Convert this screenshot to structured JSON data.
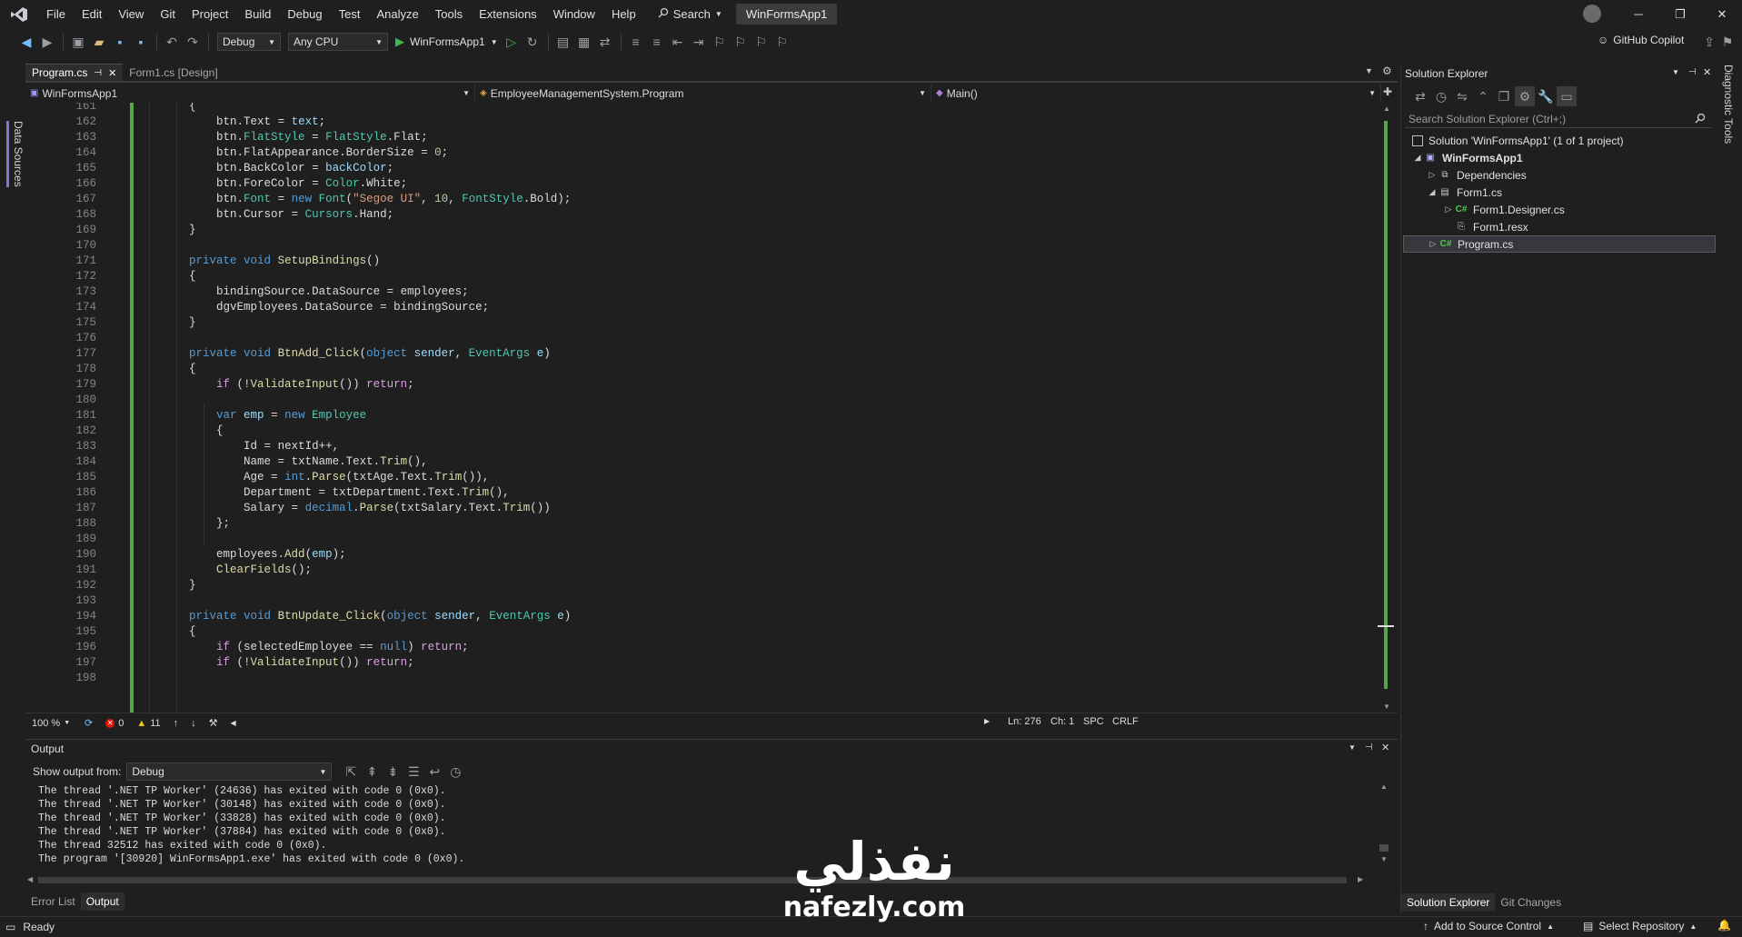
{
  "menubar": {
    "items": [
      "File",
      "Edit",
      "View",
      "Git",
      "Project",
      "Build",
      "Debug",
      "Test",
      "Analyze",
      "Tools",
      "Extensions",
      "Window",
      "Help"
    ],
    "search_label": "Search",
    "app_title": "WinFormsApp1"
  },
  "toolbar": {
    "configuration": "Debug",
    "platform": "Any CPU",
    "run_target": "WinFormsApp1",
    "copilot_label": "GitHub Copilot"
  },
  "left_tab": "Data Sources",
  "right_tab": "Diagnostic Tools",
  "editor": {
    "tabs": [
      {
        "label": "Program.cs",
        "active": true
      },
      {
        "label": "Form1.cs [Design]",
        "active": false
      }
    ],
    "nav_project": "WinFormsApp1",
    "nav_class": "EmployeeManagementSystem.Program",
    "nav_member": "Main()",
    "line_numbers": [
      "161",
      "162",
      "163",
      "164",
      "165",
      "166",
      "167",
      "168",
      "169",
      "170",
      "171",
      "172",
      "173",
      "174",
      "175",
      "176",
      "177",
      "178",
      "179",
      "180",
      "181",
      "182",
      "183",
      "184",
      "185",
      "186",
      "187",
      "188",
      "189",
      "190",
      "191",
      "192",
      "193",
      "194",
      "195",
      "196",
      "197",
      "198"
    ],
    "code_lines": [
      "        {",
      "            btn.Text = text;",
      "            btn.FlatStyle = FlatStyle.Flat;",
      "            btn.FlatAppearance.BorderSize = 0;",
      "            btn.BackColor = backColor;",
      "            btn.ForeColor = Color.White;",
      "            btn.Font = new Font(\"Segoe UI\", 10, FontStyle.Bold);",
      "            btn.Cursor = Cursors.Hand;",
      "        }",
      "",
      "        private void SetupBindings()",
      "        {",
      "            bindingSource.DataSource = employees;",
      "            dgvEmployees.DataSource = bindingSource;",
      "        }",
      "",
      "        private void BtnAdd_Click(object sender, EventArgs e)",
      "        {",
      "            if (!ValidateInput()) return;",
      "",
      "            var emp = new Employee",
      "            {",
      "                Id = nextId++,",
      "                Name = txtName.Text.Trim(),",
      "                Age = int.Parse(txtAge.Text.Trim()),",
      "                Department = txtDepartment.Text.Trim(),",
      "                Salary = decimal.Parse(txtSalary.Text.Trim())",
      "            };",
      "",
      "            employees.Add(emp);",
      "            ClearFields();",
      "        }",
      "",
      "        private void BtnUpdate_Click(object sender, EventArgs e)",
      "        {",
      "            if (selectedEmployee == null) return;",
      "            if (!ValidateInput()) return;",
      ""
    ],
    "status": {
      "zoom": "100 %",
      "errors": "0",
      "warnings": "11",
      "line": "Ln: 276",
      "char": "Ch: 1",
      "whitespace": "SPC",
      "line_ending": "CRLF"
    }
  },
  "output": {
    "title": "Output",
    "show_from_label": "Show output from:",
    "source": "Debug",
    "lines": [
      "The thread '.NET TP Worker' (24636) has exited with code 0 (0x0).",
      "The thread '.NET TP Worker' (30148) has exited with code 0 (0x0).",
      "The thread '.NET TP Worker' (33828) has exited with code 0 (0x0).",
      "The thread '.NET TP Worker' (37884) has exited with code 0 (0x0).",
      "The thread 32512 has exited with code 0 (0x0).",
      "The program '[30920] WinFormsApp1.exe' has exited with code 0 (0x0)."
    ],
    "bottom_tabs": [
      "Error List",
      "Output"
    ]
  },
  "solution_explorer": {
    "title": "Solution Explorer",
    "search_placeholder": "Search Solution Explorer (Ctrl+;)",
    "tree": [
      {
        "label": "Solution 'WinFormsApp1' (1 of 1 project)",
        "icon": "solution-icon"
      },
      {
        "label": "WinFormsApp1",
        "icon": "csproj-icon"
      },
      {
        "label": "Dependencies",
        "icon": "dependencies-icon"
      },
      {
        "label": "Form1.cs",
        "icon": "form-icon"
      },
      {
        "label": "Form1.Designer.cs",
        "icon": "csharp-file-icon"
      },
      {
        "label": "Form1.resx",
        "icon": "resx-file-icon"
      },
      {
        "label": "Program.cs",
        "icon": "csharp-file-icon"
      }
    ],
    "bottom_tabs": [
      "Solution Explorer",
      "Git Changes"
    ]
  },
  "statusbar": {
    "ready": "Ready",
    "add_source_control": "Add to Source Control",
    "select_repository": "Select Repository"
  },
  "watermark": {
    "arabic": "نفذلي",
    "latin": "nafezly.com"
  },
  "colors": {
    "background": "#1f1f1f",
    "keyword": "#569cd6",
    "type": "#4ec9b0",
    "method": "#dcdcaa",
    "parameter": "#9cdcfe",
    "string": "#d69d85",
    "number": "#b5cea8",
    "control": "#d8a0df",
    "change_bar": "#57a64a",
    "error_red": "#e51400",
    "warning_yellow": "#f0c419"
  }
}
